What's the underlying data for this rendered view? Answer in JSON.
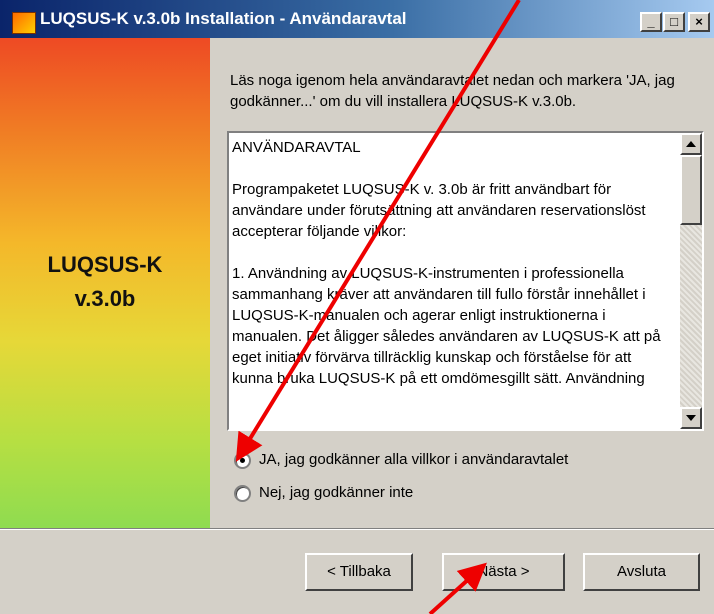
{
  "window": {
    "title": "LUQSUS-K v.3.0b Installation - Användaravtal",
    "controls": {
      "minimize": "_",
      "maximize": "□",
      "close": "×"
    }
  },
  "side_panel": {
    "title_line1": "LUQSUS-K",
    "title_line2": "v.3.0b"
  },
  "intro": "Läs noga igenom hela användaravtalet nedan och markera 'JA, jag godkänner...' om du vill installera LUQSUS-K v.3.0b.",
  "license_text": "ANVÄNDARAVTAL\n\nProgrampaketet LUQSUS-K v. 3.0b är fritt användbart för användare under förutsättning att användaren reservationslöst accepterar följande villkor:\n\n1. Användning av LUQSUS-K-instrumenten i professionella sammanhang kräver att användaren till fullo förstår innehållet i LUQSUS-K-manualen och agerar enligt instruktionerna i manualen. Det åligger således användaren av LUQSUS-K att på eget initiativ förvärva tillräcklig kunskap och förståelse för att kunna bruka LUQSUS-K på ett omdömesgillt sätt. Användning",
  "options": {
    "accept": {
      "label": "JA, jag godkänner alla villkor i användaravtalet",
      "selected": true
    },
    "decline": {
      "label": "Nej, jag godkänner inte",
      "selected": false
    }
  },
  "buttons": {
    "back": "< Tillbaka",
    "next": "Nästa >",
    "cancel": "Avsluta"
  },
  "annotation_color": "#ee0000"
}
